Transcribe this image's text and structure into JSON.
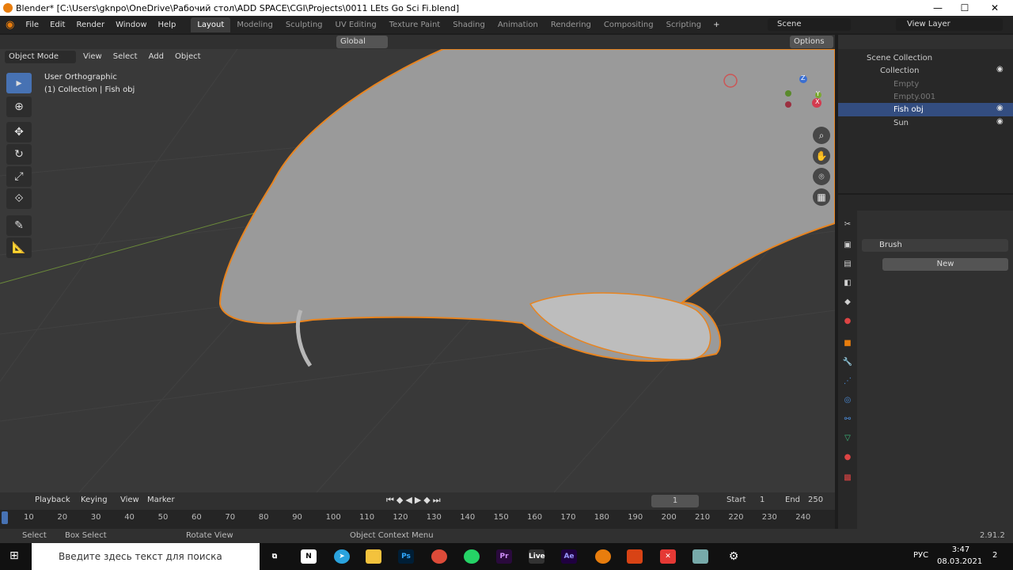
{
  "window": {
    "title": "Blender* [C:\\Users\\gknpo\\OneDrive\\Рабочий стол\\ADD SPACE\\CGI\\Projects\\0011 LEts Go Sci Fi.blend]",
    "minimize": "—",
    "maximize": "☐",
    "close": "✕"
  },
  "menu": [
    "File",
    "Edit",
    "Render",
    "Window",
    "Help"
  ],
  "workspaces": [
    "Layout",
    "Modeling",
    "Sculpting",
    "UV Editing",
    "Texture Paint",
    "Shading",
    "Animation",
    "Rendering",
    "Compositing",
    "Scripting"
  ],
  "active_workspace": "Layout",
  "scene": {
    "label": "Scene",
    "view_layer": "View Layer"
  },
  "header": {
    "transform": "Global",
    "options": "Options",
    "mode": "Object Mode",
    "menus": [
      "View",
      "Select",
      "Add",
      "Object"
    ]
  },
  "viewport": {
    "view_name": "User Orthographic",
    "collection_info": "(1) Collection | Fish obj",
    "axis_x": "X",
    "axis_y": "Y",
    "axis_z": "Z"
  },
  "outliner": {
    "root": "Scene Collection",
    "collection": "Collection",
    "items": [
      {
        "name": "Empty",
        "selected": false
      },
      {
        "name": "Empty.001",
        "selected": false
      },
      {
        "name": "Fish obj",
        "selected": true
      },
      {
        "name": "Sun",
        "selected": false
      }
    ]
  },
  "properties": {
    "panel": "Brush",
    "new_button": "New"
  },
  "timeline": {
    "menus": [
      "Playback",
      "Keying",
      "View",
      "Marker"
    ],
    "current_frame": "1",
    "start_label": "Start",
    "start": "1",
    "end_label": "End",
    "end": "250",
    "ticks": [
      "10",
      "20",
      "30",
      "40",
      "50",
      "60",
      "70",
      "80",
      "90",
      "100",
      "110",
      "120",
      "130",
      "140",
      "150",
      "160",
      "170",
      "180",
      "190",
      "200",
      "210",
      "220",
      "230",
      "240"
    ]
  },
  "status": {
    "select": "Select",
    "box_select": "Box Select",
    "rotate": "Rotate View",
    "context": "Object Context Menu",
    "version": "2.91.2"
  },
  "taskbar": {
    "search_placeholder": "Введите здесь текст для поиска",
    "lang": "РУС",
    "time": "3:47",
    "date": "08.03.2021",
    "notif": "2"
  },
  "colors": {
    "accent": "#4772b3",
    "selection_outline": "#e8841f",
    "active_tab": "#3d3d3d"
  }
}
